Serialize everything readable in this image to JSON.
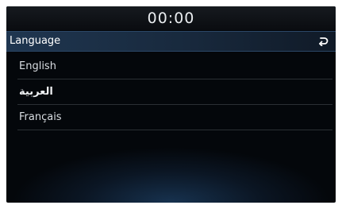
{
  "status_bar": {
    "clock": "00:00"
  },
  "header": {
    "title": "Language",
    "back_icon": "back-arrow-icon"
  },
  "languages": [
    {
      "label": "English"
    },
    {
      "label": "العربية"
    },
    {
      "label": "Français"
    }
  ],
  "colors": {
    "header_background": "#1f3650",
    "screen_background": "#05080c",
    "text": "#d9dde2"
  }
}
